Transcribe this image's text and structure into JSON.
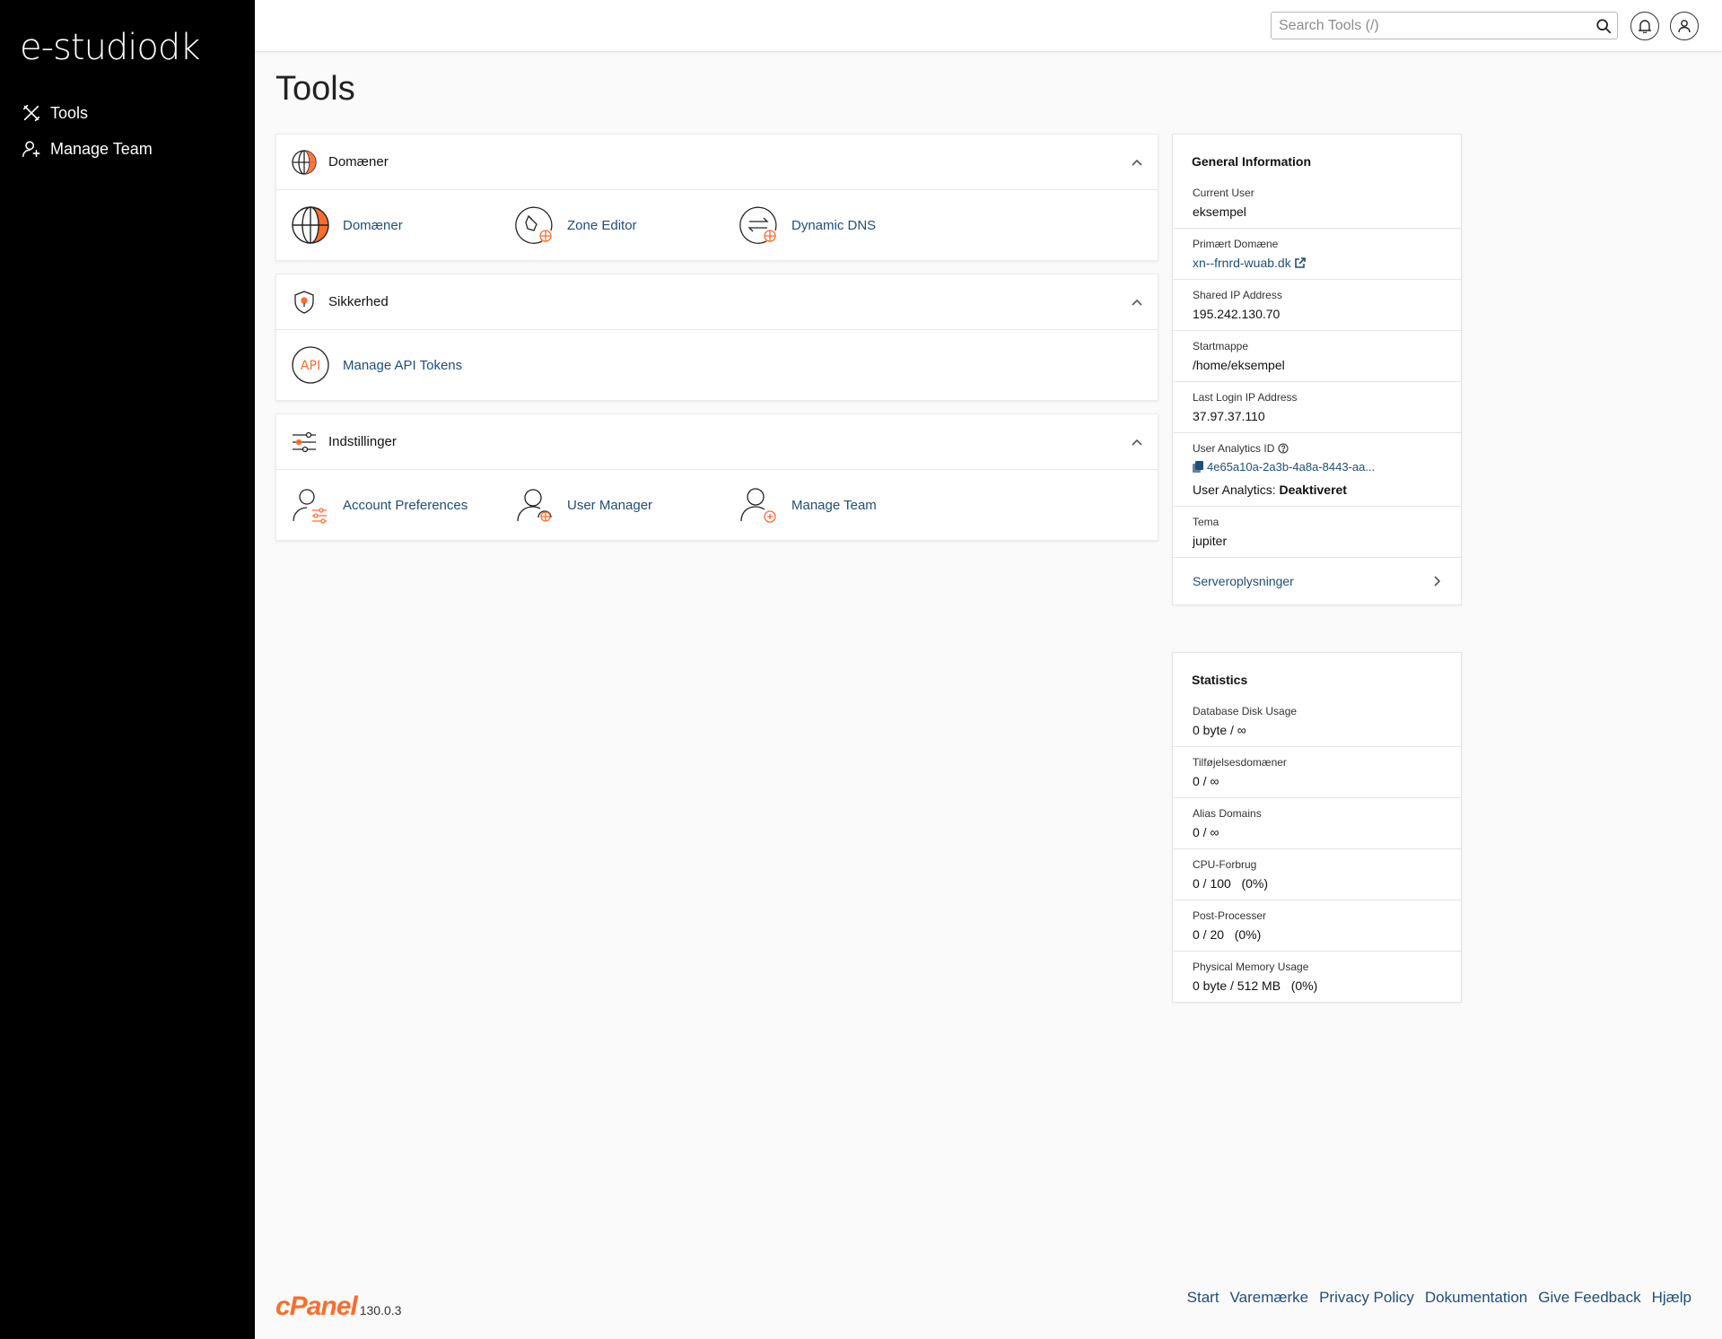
{
  "brand": {
    "logo_text": "e-studiodk"
  },
  "sidebar": {
    "items": [
      {
        "label": "Tools",
        "icon": "tools-icon"
      },
      {
        "label": "Manage Team",
        "icon": "manage-team-icon"
      }
    ]
  },
  "topbar": {
    "search_placeholder": "Search Tools (/)",
    "notifications_icon": "bell-icon",
    "user_icon": "user-icon"
  },
  "page": {
    "title": "Tools"
  },
  "sections": [
    {
      "title": "Domæner",
      "icon": "globe-icon",
      "tools": [
        {
          "label": "Domæner",
          "icon": "domains-globe-icon"
        },
        {
          "label": "Zone Editor",
          "icon": "zone-editor-icon"
        },
        {
          "label": "Dynamic DNS",
          "icon": "dynamic-dns-icon"
        }
      ]
    },
    {
      "title": "Sikkerhed",
      "icon": "shield-icon",
      "tools": [
        {
          "label": "Manage API Tokens",
          "icon": "api-icon",
          "icon_text": "API"
        }
      ]
    },
    {
      "title": "Indstillinger",
      "icon": "sliders-icon",
      "tools": [
        {
          "label": "Account Preferences",
          "icon": "account-preferences-icon"
        },
        {
          "label": "User Manager",
          "icon": "user-manager-icon"
        },
        {
          "label": "Manage Team",
          "icon": "manage-team-tool-icon"
        }
      ]
    }
  ],
  "general_info": {
    "title": "General Information",
    "current_user_label": "Current User",
    "current_user": "eksempel",
    "primary_domain_label": "Primært Domæne",
    "primary_domain": "xn--frnrd-wuab.dk",
    "shared_ip_label": "Shared IP Address",
    "shared_ip": "195.242.130.70",
    "home_label": "Startmappe",
    "home": "/home/eksempel",
    "last_login_label": "Last Login IP Address",
    "last_login": "37.97.37.110",
    "analytics_id_label": "User Analytics ID",
    "analytics_id": "4e65a10a-2a3b-4a8a-8443-aa...",
    "analytics_status_label": "User Analytics:",
    "analytics_status": "Deaktiveret",
    "theme_label": "Tema",
    "theme": "jupiter",
    "server_info_link": "Serveroplysninger"
  },
  "statistics": {
    "title": "Statistics",
    "rows": [
      {
        "label": "Database Disk Usage",
        "value": "0 byte / ∞"
      },
      {
        "label": "Tilføjelsesdomæner",
        "value": "0 / ∞"
      },
      {
        "label": "Alias Domains",
        "value": "0 / ∞"
      },
      {
        "label": "CPU-Forbrug",
        "value": "0 / 100   (0%)"
      },
      {
        "label": "Post-Processer",
        "value": "0 / 20   (0%)"
      },
      {
        "label": "Physical Memory Usage",
        "value": "0 byte / 512 MB   (0%)"
      }
    ]
  },
  "footer": {
    "brand": "cPanel",
    "version": "130.0.3",
    "links": [
      "Start",
      "Varemærke",
      "Privacy Policy",
      "Dokumentation",
      "Give Feedback",
      "Hjælp"
    ]
  },
  "colors": {
    "accent": "#ff6c2c",
    "link": "#1f4e79",
    "sidebar_bg": "#000000"
  }
}
